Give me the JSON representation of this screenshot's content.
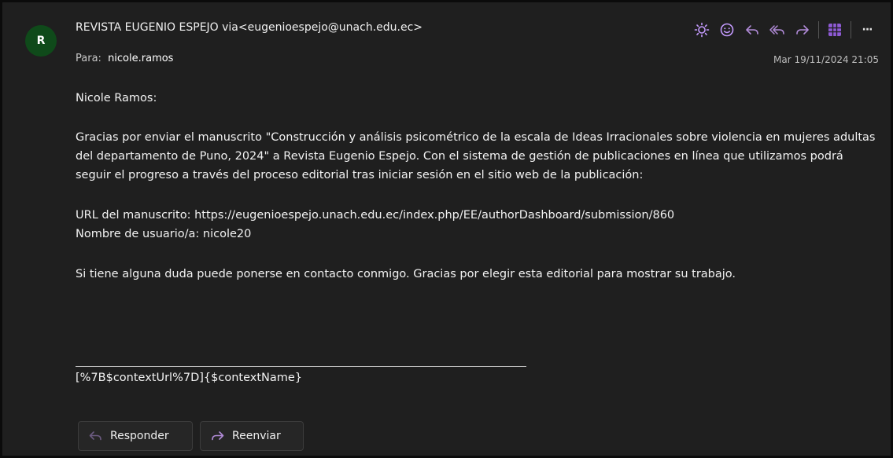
{
  "header": {
    "avatar_letter": "R",
    "sender": "REVISTA EUGENIO ESPEJO via<eugenioespejo@unach.edu.ec>",
    "to_label": "Para:",
    "to_name": "nicole.ramos",
    "date": "Mar 19/11/2024 21:05"
  },
  "toolbar": {
    "icons": [
      "sun-icon",
      "emoji-icon",
      "reply-icon",
      "reply-all-icon",
      "forward-icon",
      "grid-icon",
      "more-icon"
    ],
    "more_label": "···"
  },
  "message": {
    "greeting": "Nicole Ramos:",
    "paragraph": "Gracias por enviar el manuscrito \"Construcción y análisis psicométrico de la escala de Ideas Irracionales sobre violencia en mujeres adultas del departamento de Puno, 2024\" a Revista Eugenio Espejo. Con el sistema de gestión de publicaciones en línea que utilizamos podrá seguir el progreso a través del proceso editorial tras iniciar sesión en el sitio web de la publicación:",
    "url_line": "URL del manuscrito: https://eugenioespejo.unach.edu.ec/index.php/EE/authorDashboard/submission/860",
    "user_line": "Nombre de usuario/a: nicole20",
    "closing": "Si tiene alguna duda puede ponerse en contacto conmigo. Gracias por elegir esta editorial para mostrar su trabajo.",
    "signature": "[%7B$contextUrl%7D]{$contextName}"
  },
  "actions": {
    "reply_label": "Responder",
    "forward_label": "Reenviar"
  },
  "colors": {
    "background": "#1f1f1f",
    "avatar": "#0f4a1a",
    "sun": "#c59bff",
    "emoji": "#c59bff",
    "reply": "#b18bd8",
    "grid": "#8f5bd6"
  }
}
